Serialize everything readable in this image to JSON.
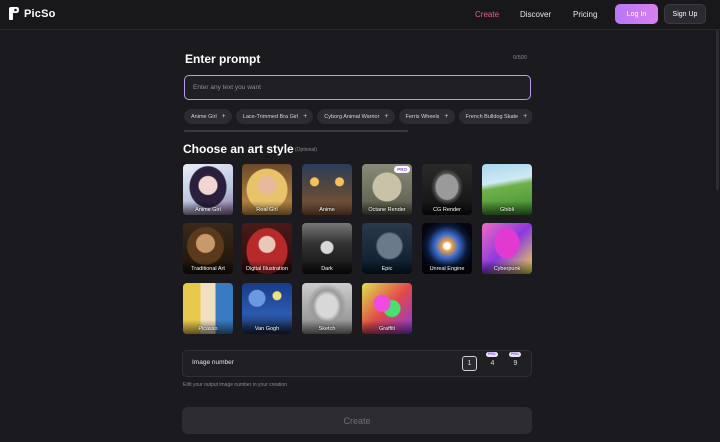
{
  "header": {
    "logo_text": "PicSo",
    "nav": [
      {
        "label": "Create",
        "active": true
      },
      {
        "label": "Discover",
        "active": false
      },
      {
        "label": "Pricing",
        "active": false
      }
    ],
    "login_label": "Log In",
    "signup_label": "Sign Up"
  },
  "prompt": {
    "title": "Enter prompt",
    "counter": "0/500",
    "placeholder": "Enter any text you want",
    "chips": [
      "Anime Girl",
      "Lace-Trimmed Bra Girl",
      "Cyborg Animal Warrior",
      "Ferris Wheels",
      "French Bulldog Skate"
    ]
  },
  "art_style": {
    "title": "Choose an art style",
    "optional": "(Optional)",
    "styles": [
      {
        "label": "Anime Girl",
        "pro": false,
        "icon": "anime-girl-thumbnail"
      },
      {
        "label": "Real Girl",
        "pro": false,
        "icon": "real-girl-thumbnail"
      },
      {
        "label": "Anime",
        "pro": false,
        "icon": "anime-street-thumbnail"
      },
      {
        "label": "Octane Render",
        "pro": true,
        "icon": "octane-render-thumbnail"
      },
      {
        "label": "CG Render",
        "pro": false,
        "icon": "cg-render-thumbnail"
      },
      {
        "label": "Ghibli",
        "pro": false,
        "icon": "ghibli-landscape-thumbnail"
      },
      {
        "label": "Traditional Art",
        "pro": false,
        "icon": "traditional-portrait-thumbnail"
      },
      {
        "label": "Digital Illustration",
        "pro": false,
        "icon": "digital-illustration-thumbnail"
      },
      {
        "label": "Dark",
        "pro": false,
        "icon": "dark-witch-thumbnail"
      },
      {
        "label": "Epic",
        "pro": false,
        "icon": "epic-dragon-thumbnail"
      },
      {
        "label": "Unreal Engine",
        "pro": false,
        "icon": "unreal-portal-thumbnail"
      },
      {
        "label": "Cyberpunk",
        "pro": false,
        "icon": "cyberpunk-robot-thumbnail"
      },
      {
        "label": "Picasso",
        "pro": false,
        "icon": "picasso-face-thumbnail"
      },
      {
        "label": "Van Gogh",
        "pro": false,
        "icon": "van-gogh-night-thumbnail"
      },
      {
        "label": "Sketch",
        "pro": false,
        "icon": "sketch-portrait-thumbnail"
      },
      {
        "label": "Graffiti",
        "pro": false,
        "icon": "graffiti-dog-thumbnail"
      }
    ],
    "pro_badge": "PRO"
  },
  "image_number": {
    "label": "Image number",
    "options": [
      {
        "value": "1",
        "selected": true,
        "pro": false
      },
      {
        "value": "4",
        "selected": false,
        "pro": true
      },
      {
        "value": "9",
        "selected": false,
        "pro": true
      }
    ],
    "pro_badge": "PRO",
    "help": "Edit your output image number in your creation"
  },
  "create_label": "Create",
  "colors": {
    "accent_pink": "#e85d8a",
    "login_gradient_start": "#b777f6",
    "login_gradient_end": "#d87ff0",
    "background": "#1b1b1f"
  }
}
